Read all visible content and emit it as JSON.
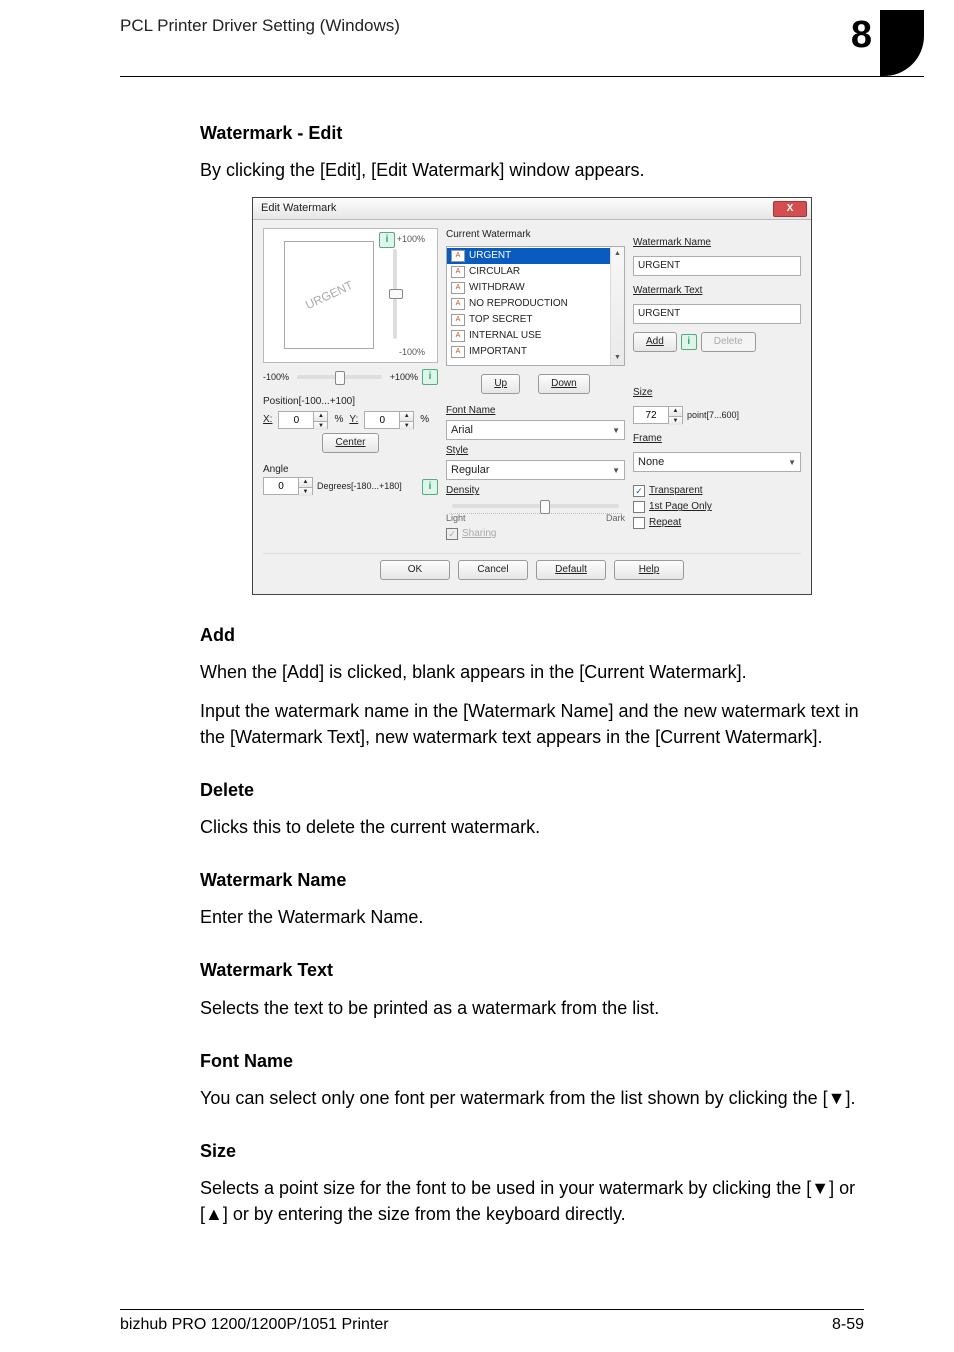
{
  "header": {
    "left": "PCL Printer Driver Setting (Windows)",
    "chapter": "8"
  },
  "sections": {
    "h1": "Watermark - Edit",
    "p1": "By clicking the [Edit], [Edit Watermark] window appears.",
    "h2": "Add",
    "p2": "When the [Add] is clicked, blank appears in the [Current Watermark].",
    "p3": "Input the watermark name in the [Watermark Name] and the new watermark text in the [Watermark Text], new watermark text appears in the [Current Watermark].",
    "h3": "Delete",
    "p4": "Clicks this to delete the current watermark.",
    "h4": "Watermark Name",
    "p5": "Enter the Watermark Name.",
    "h5": "Watermark Text",
    "p6": "Selects the text to be printed as a watermark from the list.",
    "h6": "Font Name",
    "p7": "You can select only one font per watermark from the list shown by clicking the [▼].",
    "h7": "Size",
    "p8": "Selects a point size for the font to be used in your watermark by clicking the [▼] or [▲] or by entering the size from the keyboard directly."
  },
  "dialog": {
    "title": "Edit Watermark",
    "close": "X",
    "preview": {
      "thumb_text": "URGENT",
      "pct_top": "+100%",
      "pct_bot": "-100%",
      "hs_left": "-100%",
      "hs_right": "+100%",
      "position_label": "Position[-100...+100]",
      "x_label": "X:",
      "x_value": "0",
      "x_pct": "%",
      "y_label": "Y:",
      "y_value": "0",
      "y_pct": "%",
      "center_btn": "Center",
      "angle_label": "Angle",
      "angle_value": "0",
      "angle_range": "Degrees[-180...+180]"
    },
    "current": {
      "label": "Current Watermark",
      "items": [
        "URGENT",
        "CIRCULAR",
        "WITHDRAW",
        "NO REPRODUCTION",
        "TOP SECRET",
        "INTERNAL USE",
        "IMPORTANT"
      ],
      "up": "Up",
      "down": "Down",
      "font_label": "Font Name",
      "font_value": "Arial",
      "style_label": "Style",
      "style_value": "Regular",
      "density_label": "Density",
      "light": "Light",
      "dark": "Dark",
      "sharing_label": "Sharing"
    },
    "right": {
      "name_label": "Watermark Name",
      "name_value": "URGENT",
      "text_label": "Watermark Text",
      "text_value": "URGENT",
      "add_btn": "Add",
      "delete_btn": "Delete",
      "info": "i",
      "size_label": "Size",
      "size_value": "72",
      "size_range": "point[7...600]",
      "frame_label": "Frame",
      "frame_value": "None",
      "transparent": "Transparent",
      "first_page": "1st Page Only",
      "repeat": "Repeat"
    },
    "buttons": {
      "ok": "OK",
      "cancel": "Cancel",
      "default": "Default",
      "help": "Help"
    }
  },
  "footer": {
    "left": "bizhub PRO 1200/1200P/1051 Printer",
    "right": "8-59"
  }
}
